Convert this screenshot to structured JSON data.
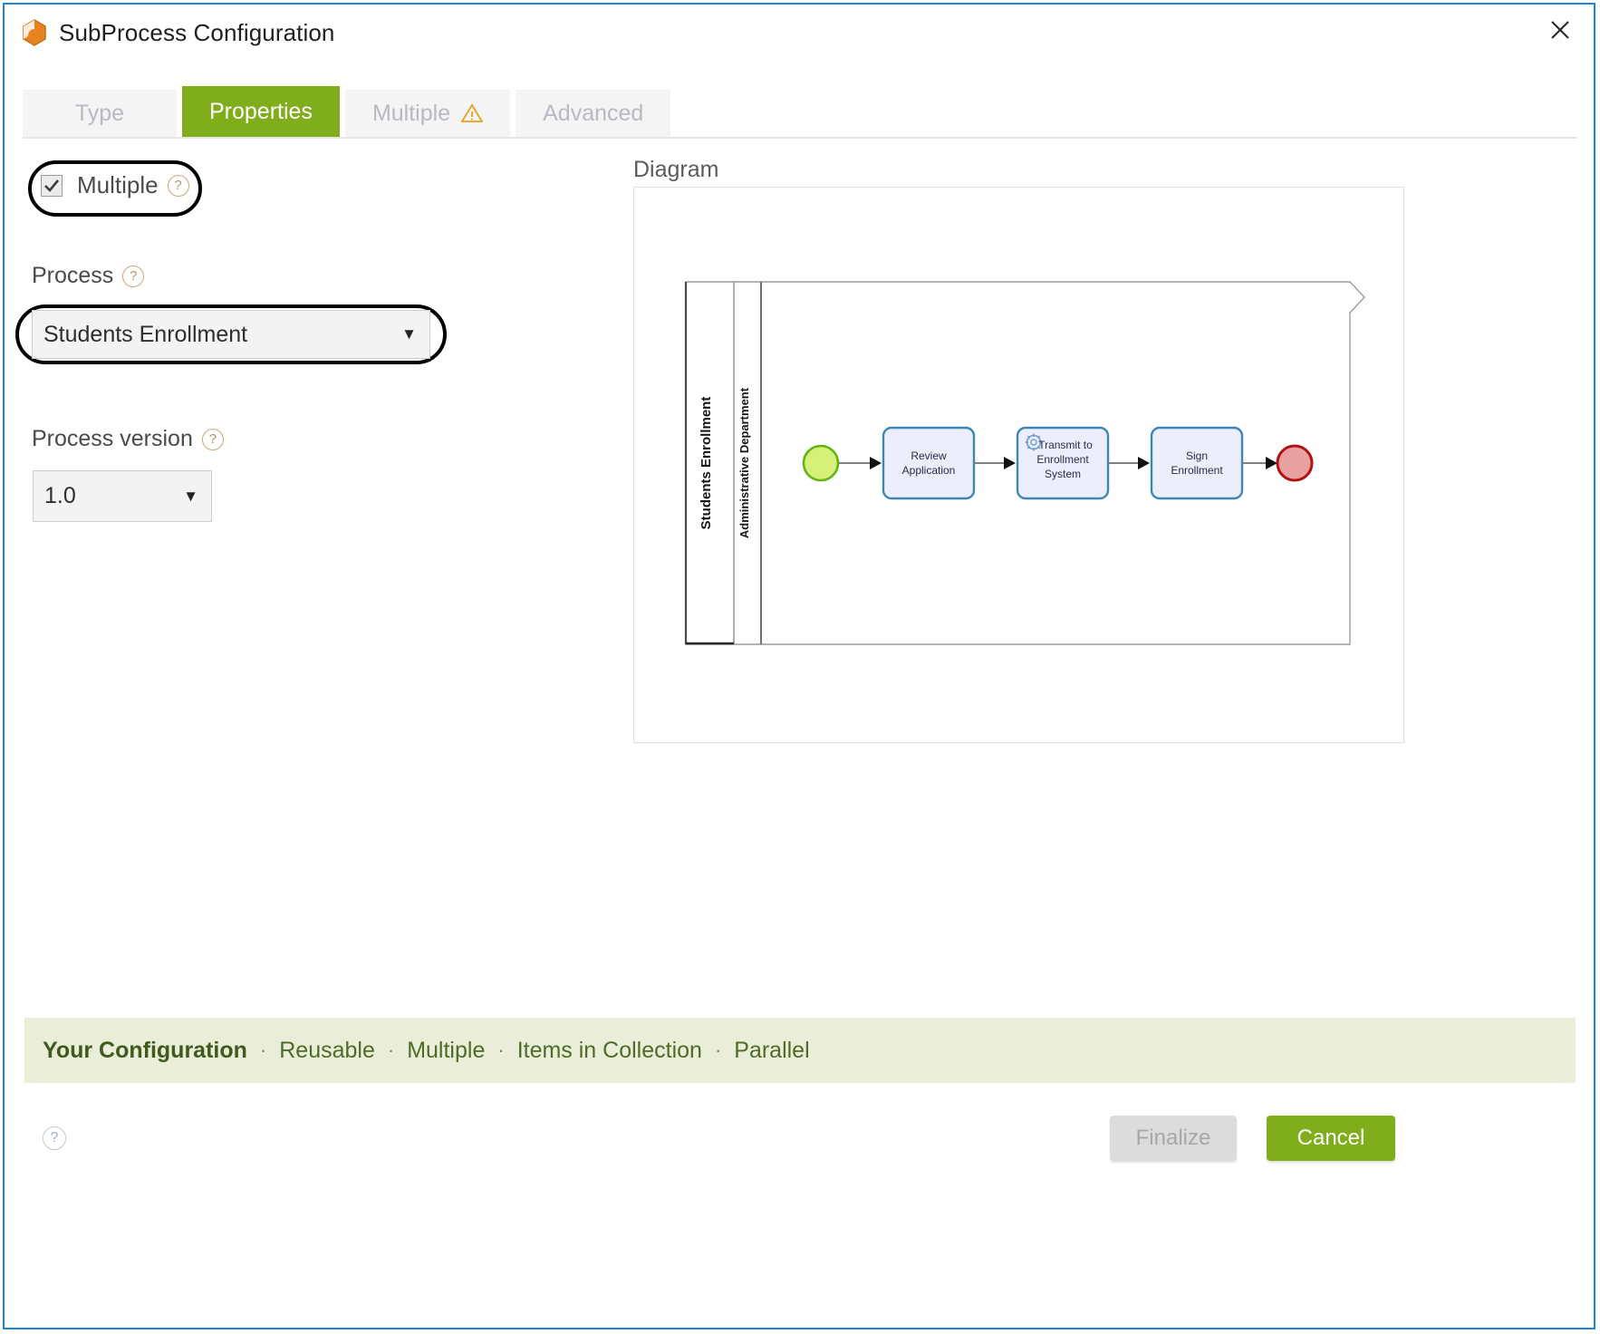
{
  "window": {
    "title": "SubProcess Configuration",
    "app_icon": "box-icon",
    "close_icon": "close-icon",
    "accent_green": "#80ad1b",
    "border_blue": "#1e85d0"
  },
  "tabs": [
    {
      "label": "Type",
      "active": false,
      "warning": false
    },
    {
      "label": "Properties",
      "active": true,
      "warning": false
    },
    {
      "label": "Multiple",
      "active": false,
      "warning": true,
      "warning_icon": "warning-triangle-icon"
    },
    {
      "label": "Advanced",
      "active": false,
      "warning": false
    }
  ],
  "form": {
    "multiple": {
      "label": "Multiple",
      "checked": true,
      "help_icon": "question-circle-icon",
      "highlighted": true
    },
    "process": {
      "label": "Process",
      "value": "Students Enrollment",
      "help_icon": "question-circle-icon",
      "caret_icon": "chevron-down-icon",
      "highlighted": true
    },
    "process_version": {
      "label": "Process version",
      "value": "1.0",
      "help_icon": "question-circle-icon",
      "caret_icon": "chevron-down-icon",
      "highlighted": false
    }
  },
  "diagram": {
    "label": "Diagram",
    "pool_label": "Students Enrollment",
    "lane_label": "Administrative Department",
    "start_event": {
      "name": "start-event",
      "fill": "#d6f07a",
      "stroke": "#63b312"
    },
    "end_event": {
      "name": "end-event",
      "fill": "#e9a0a0",
      "stroke": "#b31212"
    },
    "tasks": [
      {
        "label": "Review Application",
        "icon": null
      },
      {
        "label": "Transmit to Enrollment System",
        "icon": "gear-icon"
      },
      {
        "label": "Sign Enrollment",
        "icon": null
      }
    ],
    "task_fill": "#eceefb",
    "task_stroke": "#3c87b5"
  },
  "config_strip": {
    "lead": "Your Configuration",
    "separator": "·",
    "items": [
      "Reusable",
      "Multiple",
      "Items in Collection",
      "Parallel"
    ],
    "background": "#eaeed8",
    "text_color": "#4e6b27"
  },
  "footer": {
    "help_icon": "question-circle-icon",
    "finalize_label": "Finalize",
    "finalize_enabled": false,
    "cancel_label": "Cancel"
  }
}
